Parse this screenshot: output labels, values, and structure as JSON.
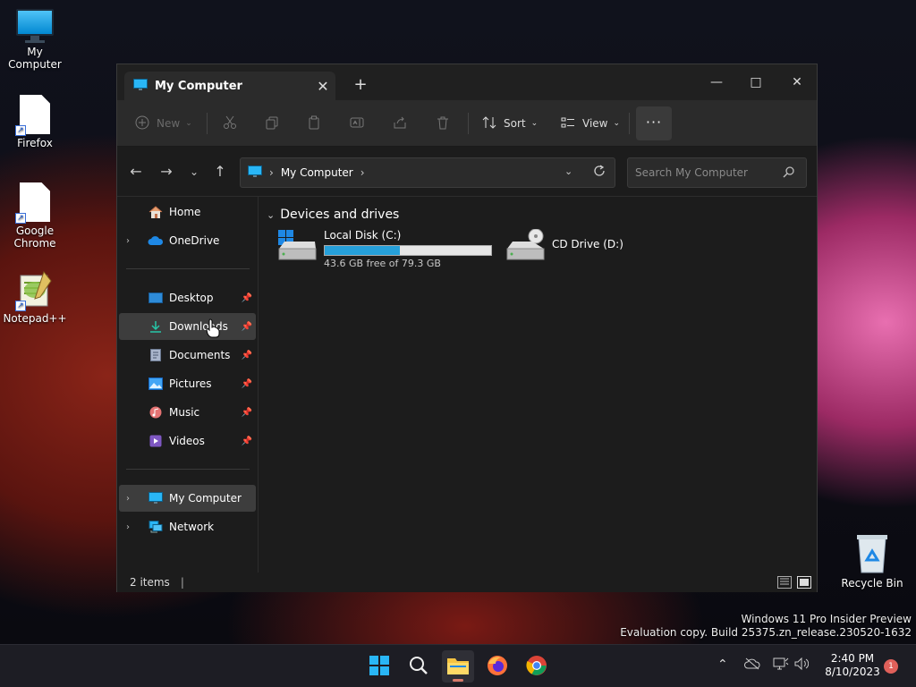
{
  "desktop": {
    "icons": [
      {
        "label": "My Computer"
      },
      {
        "label": "Firefox"
      },
      {
        "label": "Google Chrome"
      },
      {
        "label": "Notepad++"
      },
      {
        "label": "Recycle Bin"
      }
    ]
  },
  "window": {
    "tab_title": "My Computer",
    "new_tab_symbol": "+",
    "controls": {
      "minimize": "—",
      "maximize": "□",
      "close": "✕"
    }
  },
  "toolbar": {
    "new_label": "New",
    "sort_label": "Sort",
    "view_label": "View",
    "more_label": "···"
  },
  "address": {
    "path": "My Computer",
    "search_placeholder": "Search My Computer"
  },
  "sidebar": {
    "items": [
      {
        "label": "Home"
      },
      {
        "label": "OneDrive"
      },
      {
        "label": "Desktop"
      },
      {
        "label": "Downloads"
      },
      {
        "label": "Documents"
      },
      {
        "label": "Pictures"
      },
      {
        "label": "Music"
      },
      {
        "label": "Videos"
      },
      {
        "label": "My Computer"
      },
      {
        "label": "Network"
      }
    ]
  },
  "content": {
    "group_title": "Devices and drives",
    "drives": [
      {
        "label": "Local Disk (C:)",
        "free_text": "43.6 GB free of 79.3 GB",
        "used_fraction": 0.45
      },
      {
        "label": "CD Drive (D:)"
      }
    ]
  },
  "status": {
    "items_text": "2 items"
  },
  "watermark": {
    "line1": "Windows 11 Pro Insider Preview",
    "line2": "Evaluation copy. Build 25375.zn_release.230520-1632"
  },
  "taskbar": {
    "time": "2:40 PM",
    "date": "8/10/2023",
    "notification_count": "1"
  },
  "colors": {
    "accent": "#26a0da",
    "window_bg": "#1c1c1c",
    "toolbar_bg": "#2b2b2b"
  }
}
